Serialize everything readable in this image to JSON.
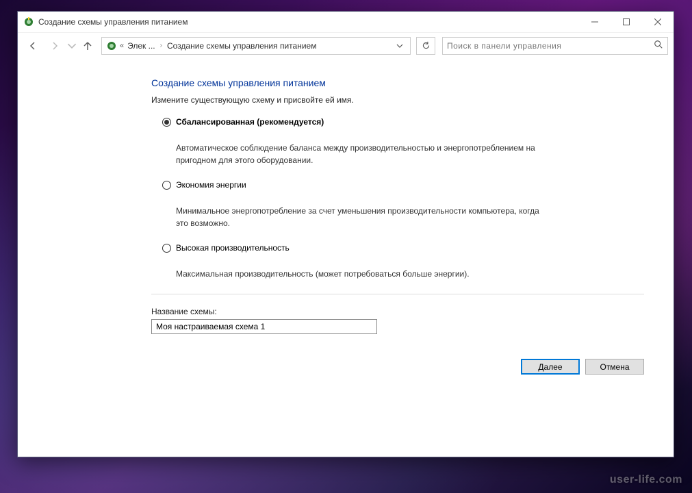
{
  "window": {
    "title": "Создание схемы управления питанием"
  },
  "breadcrumb": {
    "seg1": "Элек ...",
    "seg2": "Создание схемы управления питанием"
  },
  "search": {
    "placeholder": "Поиск в панели управления"
  },
  "page": {
    "title": "Создание схемы управления питанием",
    "subtitle": "Измените существующую схему и присвойте ей имя."
  },
  "options": {
    "balanced": {
      "label": "Сбалансированная (рекомендуется)",
      "desc": "Автоматическое соблюдение баланса между производительностью и энергопотреблением на пригодном для этого оборудовании."
    },
    "saver": {
      "label": "Экономия энергии",
      "desc": "Минимальное энергопотребление за счет уменьшения производительности компьютера, когда это возможно."
    },
    "high": {
      "label": "Высокая производительность",
      "desc": "Максимальная производительность (может потребоваться больше энергии)."
    }
  },
  "plan_name": {
    "label": "Название схемы:",
    "value": "Моя настраиваемая схема 1"
  },
  "buttons": {
    "next": "Далее",
    "cancel": "Отмена"
  },
  "watermark": "user-life.com"
}
